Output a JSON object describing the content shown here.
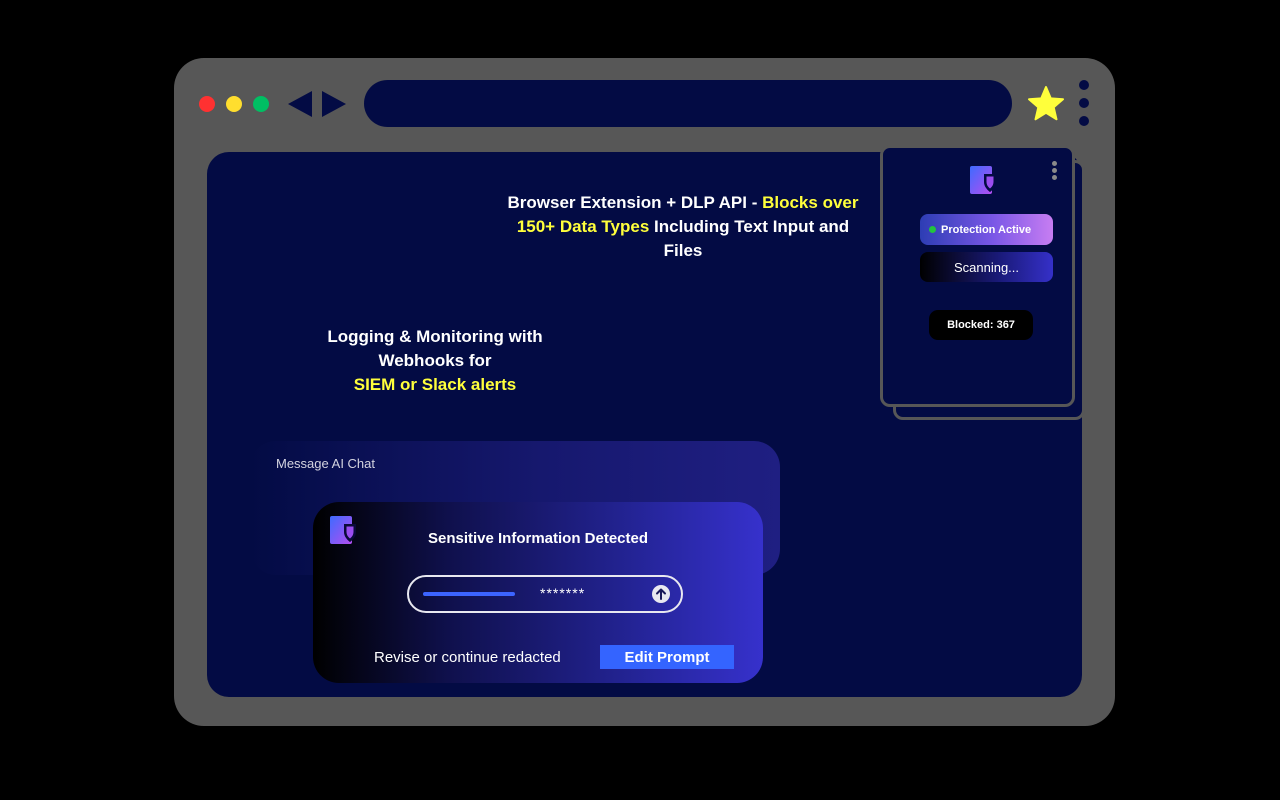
{
  "browser": {
    "icons": {
      "back": "triangle-left-icon",
      "forward": "triangle-right-icon",
      "bookmark": "star-icon",
      "menu": "vertical-dots-icon"
    },
    "colors": {
      "frame": "#575757",
      "content_bg": "#030b44",
      "close": "#ff3131",
      "minimize": "#ffde2e",
      "maximize": "#00bf63",
      "star": "#ffff3b"
    }
  },
  "headline_top": {
    "part1": "Browser Extension + DLP API - ",
    "highlight1": "Blocks over 150+ Data Types",
    "part2": " Including Text Input and Files"
  },
  "headline_left": {
    "line1": "Logging & Monitoring with",
    "line2": "Webhooks for",
    "highlight": "SIEM or Slack alerts"
  },
  "extension_popup": {
    "logo_icon": "shield-logo-icon",
    "status": "Protection Active",
    "status_color": "#22c43f",
    "scanning": "Scanning...",
    "blocked": "Blocked: 367"
  },
  "chat": {
    "placeholder": "Message AI Chat"
  },
  "alert": {
    "logo_icon": "shield-logo-icon",
    "title": "Sensitive Information Detected",
    "redacted_value": "*******",
    "send_icon": "arrow-up-circle-icon",
    "hint": "Revise or continue redacted",
    "edit_label": "Edit Prompt"
  }
}
